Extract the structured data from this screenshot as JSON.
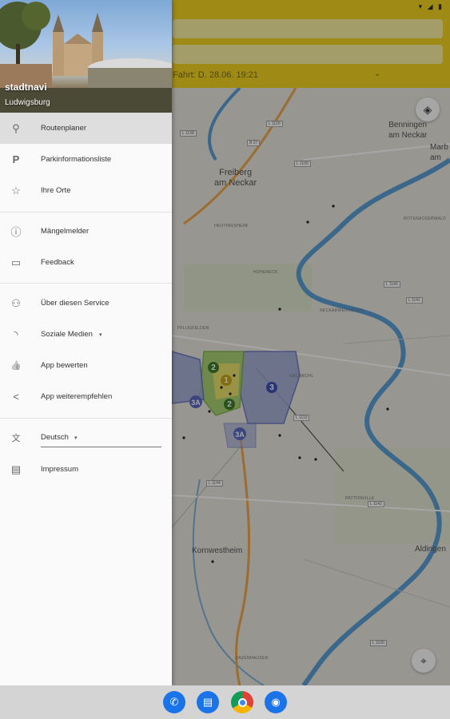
{
  "status_bar": {
    "icons": "▾ ◢ ▮"
  },
  "search": {
    "date_text": "Fahrt: D. 28.06. 19:21",
    "chevron": "⌄"
  },
  "map": {
    "labels": {
      "freiberg": "Freiberg\nam Neckar",
      "benningen": "Benningen\nam Neckar",
      "marbach": "Marb\nam",
      "kornwestheim": "Kornwestheim",
      "aldingen": "Aldingen",
      "pattonville": "PATTONVILLE",
      "hoheneck": "HOHENECK",
      "neckarweihingen": "NECKARWEIHINGEN",
      "grunbuhl": "GRÜNBÜHL",
      "rotenacker": "ROTENACKERWALD",
      "zazenhausen": "ZAZENHAUSEN",
      "pflugfelden": "PFLUGFELDEN",
      "heutingsheim": "HEUTINGSHEIM"
    },
    "road_badges": [
      "L 1138",
      "L 1129",
      "B 27",
      "L 1100",
      "L 1140",
      "L 1141",
      "L 1110",
      "L 1144",
      "L 1142",
      "L 1100"
    ],
    "zones": [
      "2",
      "1",
      "2",
      "3",
      "3A",
      "3A"
    ]
  },
  "drawer": {
    "header": {
      "title": "stadtnavi",
      "subtitle": "Ludwigsburg"
    },
    "items": [
      {
        "icon": "location-pin-icon",
        "glyph": "⚲",
        "label": "Routenplaner",
        "active": true
      },
      {
        "icon": "parking-icon",
        "glyph": "P",
        "label": "Parkinformationsliste"
      },
      {
        "icon": "star-icon",
        "glyph": "☆",
        "label": "Ihre Orte"
      },
      {
        "icon": "info-icon",
        "glyph": "ⓘ",
        "label": "Mängelmelder"
      },
      {
        "icon": "feedback-icon",
        "glyph": "▭",
        "label": "Feedback"
      },
      {
        "icon": "group-icon",
        "glyph": "⚇",
        "label": "Über diesen Service"
      },
      {
        "icon": "rss-icon",
        "glyph": "◝",
        "label": "Soziale Medien"
      },
      {
        "icon": "thumb-up-icon",
        "glyph": "👍",
        "label": "App bewerten"
      },
      {
        "icon": "share-icon",
        "glyph": "<",
        "label": "App weiterempfehlen"
      },
      {
        "icon": "translate-icon",
        "glyph": "文",
        "label": "Deutsch"
      },
      {
        "icon": "document-icon",
        "glyph": "▤",
        "label": "Impressum"
      }
    ],
    "dropdown_caret": "▾"
  },
  "nav": {
    "phone": "✆",
    "messages": "▤",
    "camera": "◉"
  },
  "colors": {
    "accent": "#f5d421",
    "zone_green": "#7cb342",
    "zone_blue": "#5c6bc0",
    "river": "#5a9fd4"
  }
}
